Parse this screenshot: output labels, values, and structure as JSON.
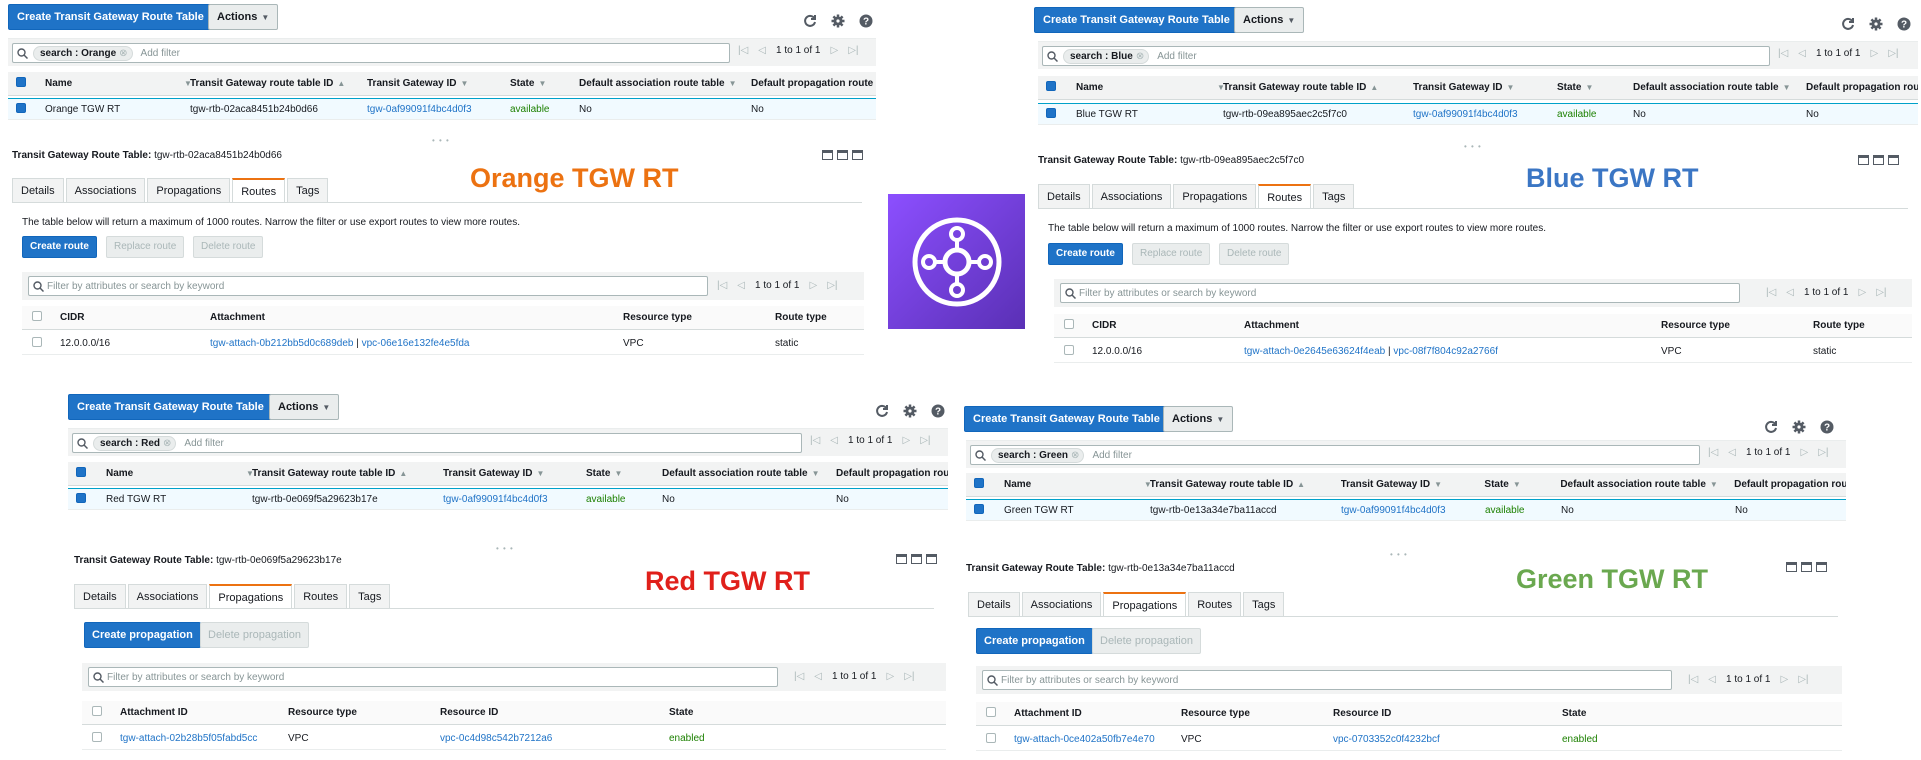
{
  "toolbar": {
    "create_label": "Create Transit Gateway Route Table",
    "actions_label": "Actions"
  },
  "search": {
    "add_filter": "Add filter"
  },
  "pagination": {
    "text": "1 to 1 of 1"
  },
  "columns": {
    "name": "Name",
    "rt_id": "Transit Gateway route table ID",
    "tgw_id": "Transit Gateway ID",
    "state": "State",
    "assoc": "Default association route table",
    "prop": "Default propagation route"
  },
  "detail_prefix": "Transit Gateway Route Table:",
  "tabs": [
    "Details",
    "Associations",
    "Propagations",
    "Routes",
    "Tags"
  ],
  "routes_view": {
    "note": "The table below will return a maximum of 1000 routes. Narrow the filter or use export routes to view more routes.",
    "create": "Create route",
    "replace": "Replace route",
    "delete": "Delete route",
    "filter_placeholder": "Filter by attributes or search by keyword",
    "columns": {
      "cidr": "CIDR",
      "attachment": "Attachment",
      "resource_type": "Resource type",
      "route_type": "Route type"
    }
  },
  "propagations_view": {
    "create": "Create propagation",
    "delete": "Delete propagation",
    "filter_placeholder": "Filter by attributes or search by keyword",
    "columns": {
      "attachment_id": "Attachment ID",
      "resource_type": "Resource type",
      "resource_id": "Resource ID",
      "state": "State"
    }
  },
  "panels": {
    "orange": {
      "search_token": "search : Orange",
      "row": {
        "name": "Orange TGW RT",
        "rt_id": "tgw-rtb-02aca8451b24b0d66",
        "tgw_id": "tgw-0af99091f4bc4d0f3",
        "state": "available",
        "assoc": "No",
        "prop": "No"
      },
      "detail_id": "tgw-rtb-02aca8451b24b0d66",
      "label": "Orange TGW RT",
      "label_color": "#ec7211",
      "route": {
        "cidr": "12.0.0.0/16",
        "attach": "tgw-attach-0b212bb5d0c689deb",
        "sep": "|",
        "vpc": "vpc-06e16e132fe4e5fda",
        "resource_type": "VPC",
        "route_type": "static"
      }
    },
    "blue": {
      "search_token": "search : Blue",
      "row": {
        "name": "Blue TGW RT",
        "rt_id": "tgw-rtb-09ea895aec2c5f7c0",
        "tgw_id": "tgw-0af99091f4bc4d0f3",
        "state": "available",
        "assoc": "No",
        "prop": "No"
      },
      "detail_id": "tgw-rtb-09ea895aec2c5f7c0",
      "label": "Blue TGW RT",
      "label_color": "#3b76c4",
      "route": {
        "cidr": "12.0.0.0/16",
        "attach": "tgw-attach-0e2645e63624f4eab",
        "sep": "|",
        "vpc": "vpc-08f7f804c92a2766f",
        "resource_type": "VPC",
        "route_type": "static"
      }
    },
    "red": {
      "search_token": "search : Red",
      "row": {
        "name": "Red TGW RT",
        "rt_id": "tgw-rtb-0e069f5a29623b17e",
        "tgw_id": "tgw-0af99091f4bc4d0f3",
        "state": "available",
        "assoc": "No",
        "prop": "No"
      },
      "detail_id": "tgw-rtb-0e069f5a29623b17e",
      "label": "Red TGW RT",
      "label_color": "#e0201b",
      "prop": {
        "attachment_id": "tgw-attach-02b28b5f05fabd5cc",
        "resource_type": "VPC",
        "resource_id": "vpc-0c4d98c542b7212a6",
        "state": "enabled"
      }
    },
    "green": {
      "search_token": "search : Green",
      "row": {
        "name": "Green TGW RT",
        "rt_id": "tgw-rtb-0e13a34e7ba11accd",
        "tgw_id": "tgw-0af99091f4bc4d0f3",
        "state": "available",
        "assoc": "No",
        "prop": "No"
      },
      "detail_id": "tgw-rtb-0e13a34e7ba11accd",
      "label": "Green TGW RT",
      "label_color": "#6aa84f",
      "prop": {
        "attachment_id": "tgw-attach-0ce402a50fb7e4e70",
        "resource_type": "VPC",
        "resource_id": "vpc-0703352c0f4232bcf",
        "state": "enabled"
      }
    }
  },
  "colors": {
    "primary": "#1f73c7",
    "success": "#1d8102",
    "logo": "#8c4fff"
  },
  "icons": [
    "refresh-icon",
    "gear-icon",
    "help-icon",
    "search-icon",
    "transit-gateway-logo-icon"
  ]
}
